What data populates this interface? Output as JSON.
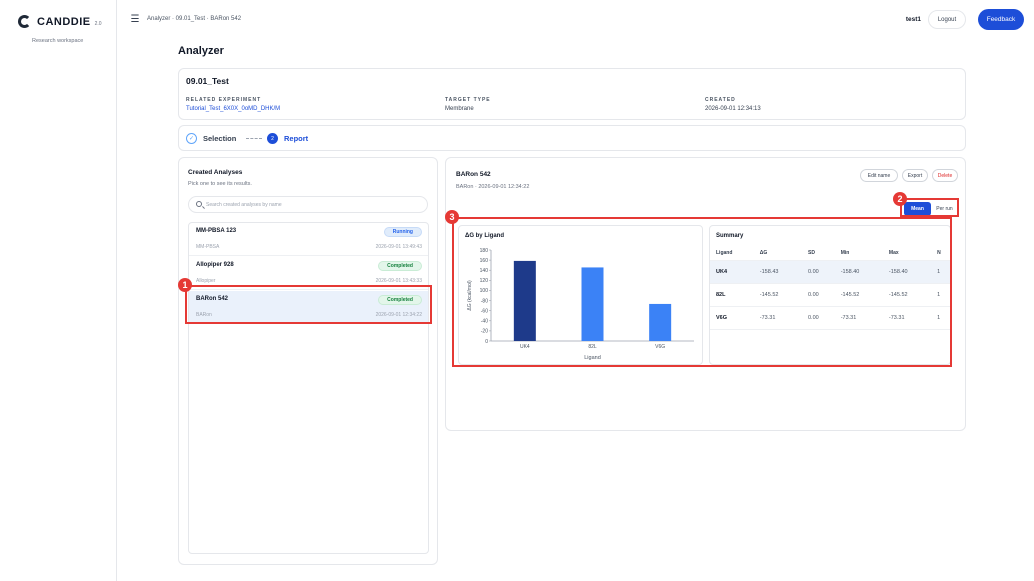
{
  "sidebar": {
    "brand": "CANDDIE",
    "version": "2.0",
    "subtitle": "Research workspace"
  },
  "topbar": {
    "breadcrumb": "Analyzer · 09.01_Test · BARon 542",
    "user": "test1",
    "logout_label": "Logout",
    "feedback_label": "Feedback"
  },
  "page": {
    "title": "Analyzer"
  },
  "experiment": {
    "title": "09.01_Test",
    "related_label": "RELATED EXPERIMENT",
    "related_value": "Tutorial_Test_6X0X_0oMD_DHK/M",
    "target_label": "TARGET TYPE",
    "target_value": "Membrane",
    "created_label": "CREATED",
    "created_value": "2026-09-01 12:34:13"
  },
  "stepper": {
    "step1": "Selection",
    "step2_num": "2",
    "step2": "Report"
  },
  "analyses": {
    "title": "Created Analyses",
    "subtitle": "Pick one to see its results.",
    "search_placeholder": "Search created analyses by name",
    "items": [
      {
        "name": "MM-PBSA 123",
        "type": "MM-PBSA",
        "date": "2026-09-01 13:49:43",
        "status": "Running"
      },
      {
        "name": "Allopiper 928",
        "type": "Allopiper",
        "date": "2026-09-01 13:43:33",
        "status": "Completed"
      },
      {
        "name": "BARon 542",
        "type": "BARon",
        "date": "2026-09-01 12:34:22",
        "status": "Completed"
      }
    ]
  },
  "detail": {
    "title": "BARon 542",
    "subtitle": "BARon · 2026-09-01 12:34:22",
    "edit_label": "Edit name",
    "export_label": "Export",
    "delete_label": "Delete",
    "mean_label": "Mean",
    "perrun_label": "Per run"
  },
  "chart_data": {
    "type": "bar",
    "title": "ΔG by Ligand",
    "xlabel": "Ligand",
    "ylabel": "ΔG (kcal/mol)",
    "categories": [
      "UK4",
      "82L",
      "V6G"
    ],
    "values": [
      158.43,
      145.52,
      73.31
    ],
    "colors": [
      "#1e3a8a",
      "#3b82f6",
      "#3b82f6"
    ],
    "yticks": [
      0,
      -20,
      -40,
      -60,
      -80,
      100,
      120,
      140,
      160,
      180
    ],
    "ytick_labels": [
      "0",
      "-20",
      "-40",
      "-60",
      "-80",
      "100",
      "120",
      "140",
      "160",
      "180"
    ],
    "ylim": [
      0,
      180
    ],
    "grid": false
  },
  "summary": {
    "title": "Summary",
    "headers": [
      "Ligand",
      "ΔG",
      "SD",
      "Min",
      "Max",
      "N"
    ],
    "rows": [
      [
        "UK4",
        "-158.43",
        "0.00",
        "-158.40",
        "-158.40",
        "1"
      ],
      [
        "82L",
        "-145.52",
        "0.00",
        "-145.52",
        "-145.52",
        "1"
      ],
      [
        "V6G",
        "-73.31",
        "0.00",
        "-73.31",
        "-73.31",
        "1"
      ]
    ]
  },
  "annotations": [
    "1",
    "2",
    "3"
  ],
  "colors": {
    "accent": "#1d4ed8",
    "annotation": "#e53935"
  }
}
